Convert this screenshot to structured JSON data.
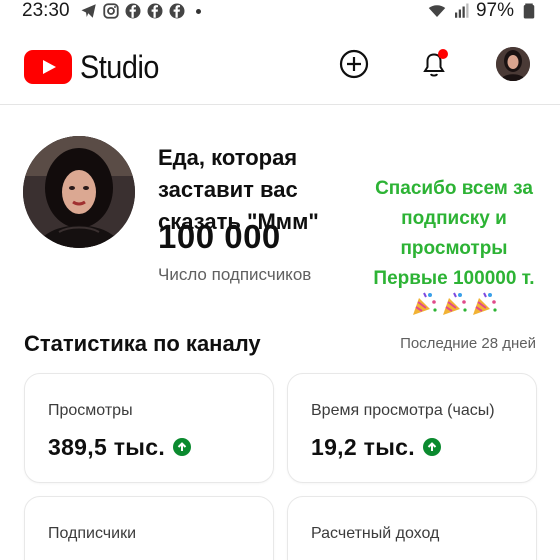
{
  "status_bar": {
    "time": "23:30",
    "battery": "97%",
    "icons": [
      "telegram-icon",
      "instagram-icon",
      "facebook-icon",
      "facebook-icon",
      "facebook-icon",
      "dot-icon",
      "wifi-icon",
      "signal-icon",
      "battery-icon"
    ]
  },
  "header": {
    "logo_text": "Studio",
    "icons": [
      "create-icon",
      "notifications-icon",
      "account-avatar"
    ],
    "notification_dot_color": "#ff0000"
  },
  "channel": {
    "name": "Еда, которая заставит вас сказать \"Ммм\"",
    "subscribers": "100 000",
    "subscribers_label": "Число подписчиков"
  },
  "overlay": {
    "lines": [
      "Спасибо всем за",
      "подписку и",
      "просмотры",
      "Первые 100000 т."
    ],
    "color": "#2db335",
    "emoji": "party-popper-icon"
  },
  "stats": {
    "title": "Статистика по каналу",
    "period": "Последние 28 дней",
    "cards": [
      {
        "label": "Просмотры",
        "value": "389,5 тыс.",
        "trend": "up"
      },
      {
        "label": "Время просмотра (часы)",
        "value": "19,2 тыс.",
        "trend": "up"
      },
      {
        "label": "Подписчики",
        "value": "",
        "trend": ""
      },
      {
        "label": "Расчетный доход",
        "value": "",
        "trend": ""
      }
    ]
  },
  "colors": {
    "brand_red": "#ff0000",
    "trend_up": "#0b8a2f",
    "secondary_text": "#606060"
  }
}
